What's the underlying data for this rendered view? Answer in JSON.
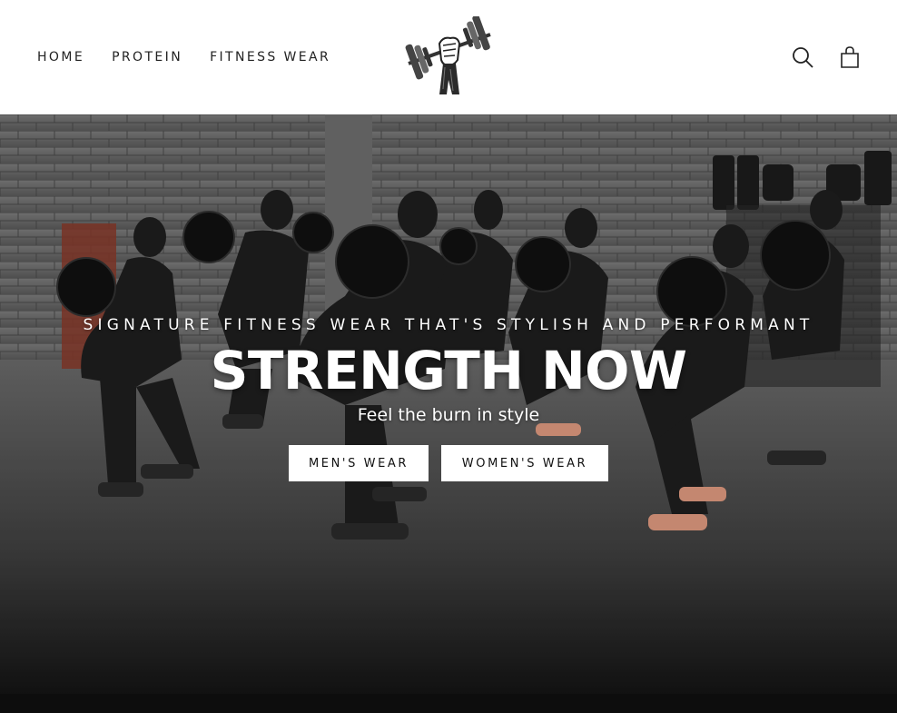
{
  "header": {
    "nav": [
      {
        "label": "HOME"
      },
      {
        "label": "PROTEIN"
      },
      {
        "label": "FITNESS WEAR"
      }
    ],
    "icons": {
      "logo": "dumbbell-fist-logo",
      "search": "search-icon",
      "cart": "cart-icon"
    }
  },
  "hero": {
    "subheading": "SIGNATURE FITNESS WEAR THAT'S STYLISH AND PERFORMANT",
    "headline": "STRENGTH NOW",
    "tagline": "Feel the burn in style",
    "buttons": [
      {
        "label": "MEN'S WEAR"
      },
      {
        "label": "WOMEN'S WEAR"
      }
    ]
  },
  "colors": {
    "header_bg": "#ffffff",
    "text": "#222222",
    "button_bg": "#ffffff",
    "footer_bar": "#0d0d0d"
  }
}
